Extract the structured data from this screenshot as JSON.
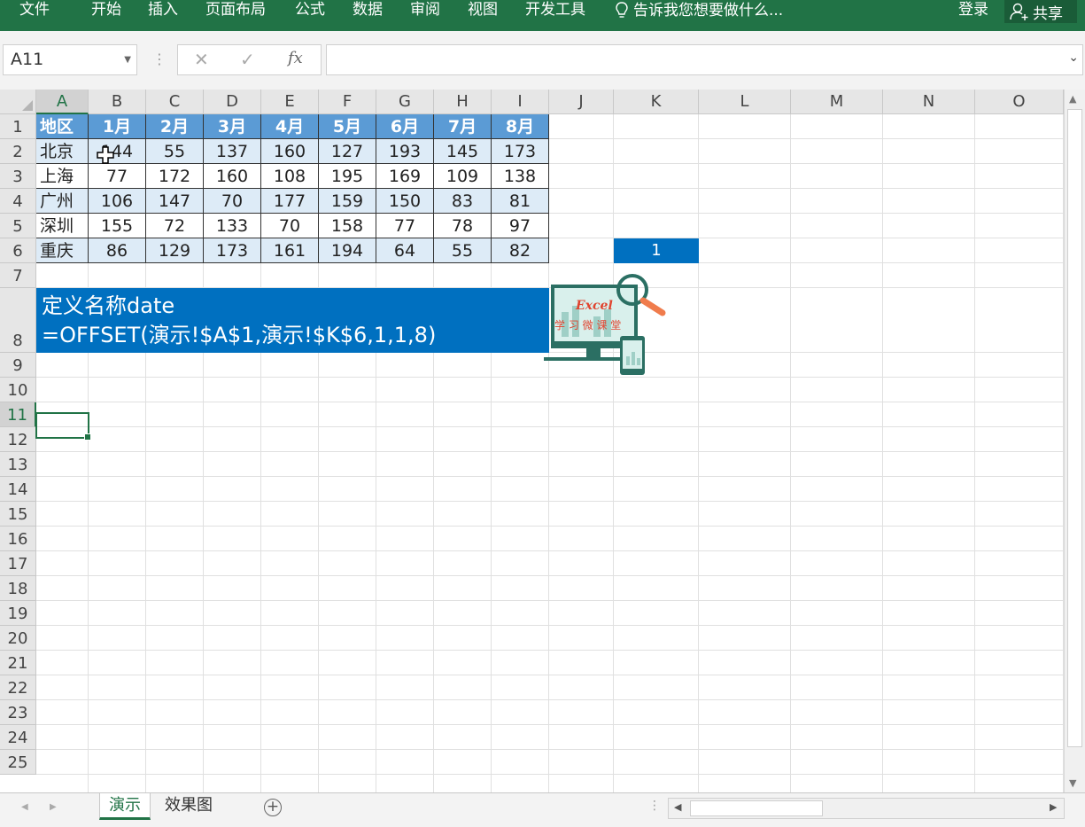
{
  "ribbon": {
    "tabs": [
      "文件",
      "开始",
      "插入",
      "页面布局",
      "公式",
      "数据",
      "审阅",
      "视图",
      "开发工具"
    ],
    "tell_me": "告诉我您想要做什么...",
    "login": "登录",
    "share": "共享",
    "bg_color": "#217346"
  },
  "formula_bar": {
    "name_box": "A11",
    "formula": "",
    "fx_label": "fx"
  },
  "columns": [
    "A",
    "B",
    "C",
    "D",
    "E",
    "F",
    "G",
    "H",
    "I",
    "J",
    "K",
    "L",
    "M",
    "N",
    "O"
  ],
  "selected_column": "A",
  "rows": [
    "1",
    "2",
    "3",
    "4",
    "5",
    "6",
    "7",
    "8",
    "9",
    "10",
    "11",
    "12",
    "13",
    "14",
    "15",
    "16",
    "17",
    "18",
    "19",
    "20",
    "21",
    "22",
    "23",
    "24",
    "25"
  ],
  "selected_row": "11",
  "table": {
    "header": [
      "地区",
      "1月",
      "2月",
      "3月",
      "4月",
      "5月",
      "6月",
      "7月",
      "8月"
    ],
    "rows": [
      [
        "北京",
        "144",
        "55",
        "137",
        "160",
        "127",
        "193",
        "145",
        "173"
      ],
      [
        "上海",
        "77",
        "172",
        "160",
        "108",
        "195",
        "169",
        "109",
        "138"
      ],
      [
        "广州",
        "106",
        "147",
        "70",
        "177",
        "159",
        "150",
        "83",
        "81"
      ],
      [
        "深圳",
        "155",
        "72",
        "133",
        "70",
        "158",
        "77",
        "78",
        "97"
      ],
      [
        "重庆",
        "86",
        "129",
        "173",
        "161",
        "194",
        "64",
        "55",
        "82"
      ]
    ],
    "header_color": "#5b9bd5",
    "band_color": "#ddebf7"
  },
  "k6_value": "1",
  "note": {
    "line1": "定义名称date",
    "line2": "=OFFSET(演示!$A$1,演示!$K$6,1,1,8)",
    "color": "#0070c0"
  },
  "logo": {
    "title": "Excel",
    "subtitle": "学习微课堂"
  },
  "sheet_tabs": {
    "tabs": [
      "演示",
      "效果图"
    ],
    "active": "演示"
  }
}
